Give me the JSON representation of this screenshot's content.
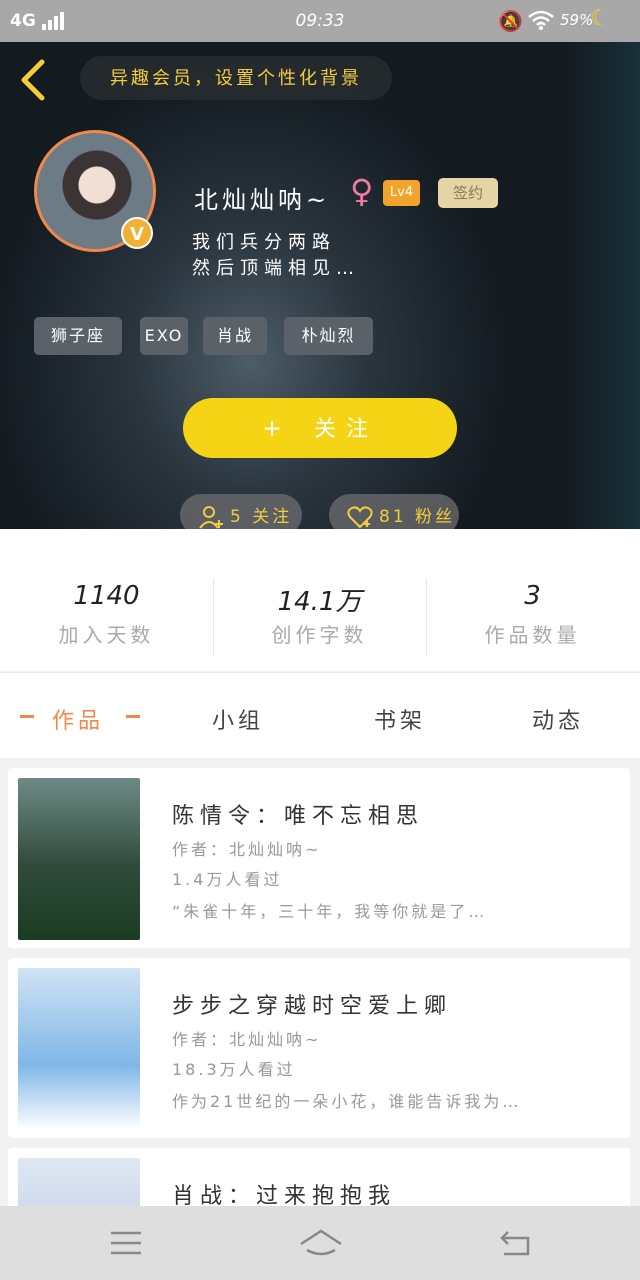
{
  "status_bar": {
    "network": "4G",
    "time": "09:33",
    "battery": "59%",
    "icons": [
      "signal-icon",
      "mute-icon",
      "wifi-icon",
      "moon-icon"
    ]
  },
  "header": {
    "background_hint": "异趣会员，设置个性化背景",
    "username": "北灿灿呐~",
    "gender_symbol": "♀",
    "level": "Lv4",
    "sign_label": "签约",
    "bio_line1": "我们兵分两路",
    "bio_line2": "然后顶端相见…",
    "avatar_badge": "V",
    "tags": [
      "狮子座",
      "EXO",
      "肖战",
      "朴灿烈"
    ],
    "follow_label": "关注",
    "following": "5 关注",
    "fans": "81 粉丝"
  },
  "stats": [
    {
      "value": "1140",
      "label": "加入天数"
    },
    {
      "value": "14.1万",
      "label": "创作字数"
    },
    {
      "value": "3",
      "label": "作品数量"
    }
  ],
  "tabs": [
    {
      "label": "作品",
      "active": true
    },
    {
      "label": "小组",
      "active": false
    },
    {
      "label": "书架",
      "active": false
    },
    {
      "label": "动态",
      "active": false
    }
  ],
  "works": [
    {
      "title": "陈情令：唯不忘相思",
      "author": "作者：北灿灿呐~",
      "views": "1.4万人看过",
      "desc": "“朱雀十年，三十年，我等你就是了…",
      "cover_color": "#2f4a3a"
    },
    {
      "title": "步步之穿越时空爱上卿",
      "author": "作者：北灿灿呐~",
      "views": "18.3万人看过",
      "desc": "作为21世纪的一朵小花，谁能告诉我为…",
      "cover_color": "#7fb7e8"
    },
    {
      "title": "肖战：过来抱抱我",
      "author": "",
      "views": "",
      "desc": "",
      "cover_color": "#c8d6ea"
    }
  ],
  "colors": {
    "accent": "#f5d415",
    "orange": "#f08a4b",
    "gold_text": "#f4cd3b"
  }
}
